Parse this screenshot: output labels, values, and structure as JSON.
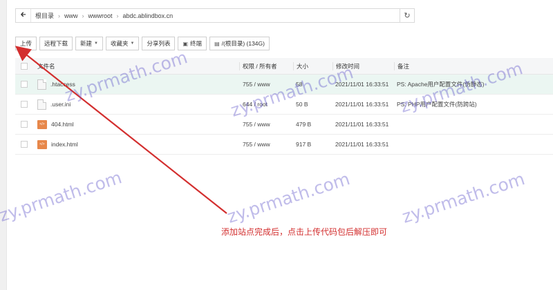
{
  "path_bar": {
    "back_icon": "arrow-left-icon",
    "crumbs": [
      "根目录",
      "www",
      "wwwroot",
      "abdc.ablindbox.cn"
    ],
    "refresh_icon": "refresh-icon"
  },
  "toolbar": {
    "upload": "上传",
    "remote_download": "远程下载",
    "new": "新建",
    "favorites": "收藏夹",
    "share_list": "分享列表",
    "terminal": "终端",
    "root_disk": "/(根目录) (134G)"
  },
  "table": {
    "headers": {
      "name": "文件名",
      "perm": "权限 / 所有者",
      "size": "大小",
      "time": "修改时间",
      "note": "备注"
    },
    "rows": [
      {
        "name": ".htaccess",
        "perm": "755 / www",
        "size": "58",
        "time": "2021/11/01 16:33:51",
        "note": "PS: Apache用户配置文件(伪静态)",
        "icon": "text-file-icon",
        "highlight": true
      },
      {
        "name": ".user.ini",
        "perm": "644 / root",
        "size": "50 B",
        "time": "2021/11/01 16:33:51",
        "note": "PS: PHP用户配置文件(防跨站)",
        "icon": "text-file-icon",
        "highlight": false
      },
      {
        "name": "404.html",
        "perm": "755 / www",
        "size": "479 B",
        "time": "2021/11/01 16:33:51",
        "note": "",
        "icon": "html-file-icon",
        "highlight": false
      },
      {
        "name": "index.html",
        "perm": "755 / www",
        "size": "917 B",
        "time": "2021/11/01 16:33:51",
        "note": "",
        "icon": "html-file-icon",
        "highlight": false
      }
    ]
  },
  "annotation": {
    "text": "添加站点完成后，点击上传代码包后解压即可",
    "color": "#d32f2f"
  },
  "watermark": "zy.prmath.com",
  "colors": {
    "highlight_row": "#ebf6f2",
    "annotation_red": "#d32f2f"
  }
}
